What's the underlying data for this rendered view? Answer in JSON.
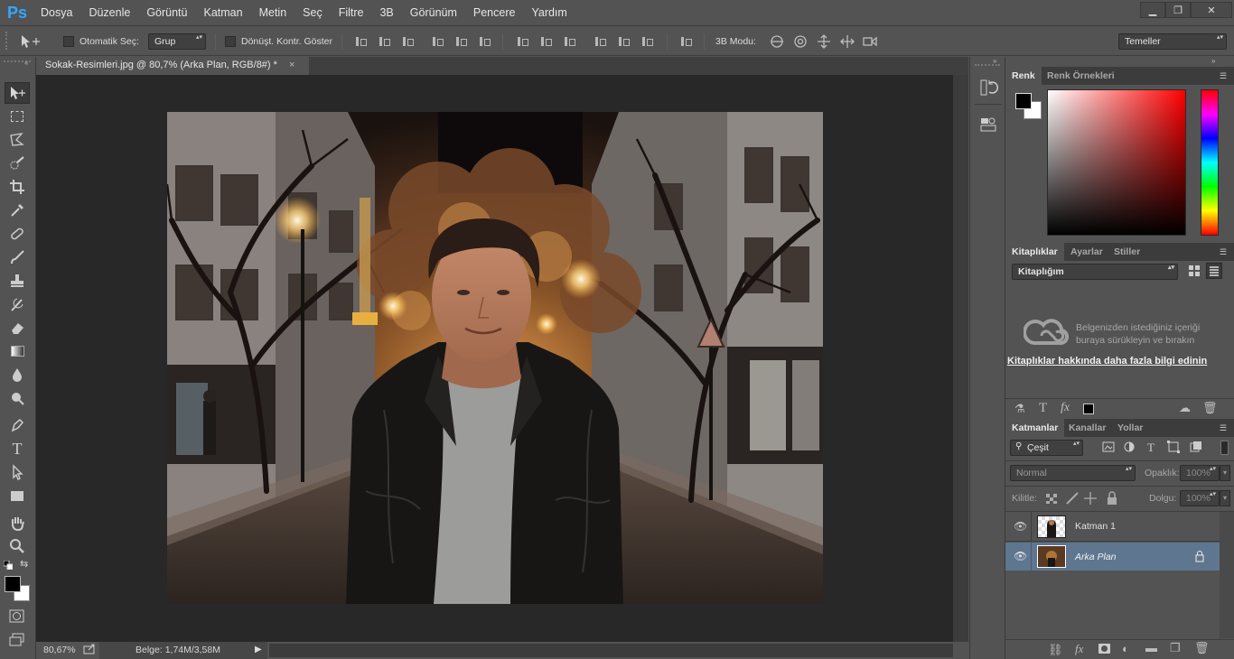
{
  "app": {
    "logo": "Ps"
  },
  "menu": [
    "Dosya",
    "Düzenle",
    "Görüntü",
    "Katman",
    "Metin",
    "Seç",
    "Filtre",
    "3B",
    "Görünüm",
    "Pencere",
    "Yardım"
  ],
  "window_controls": {
    "minimize": "▁",
    "restore": "❐",
    "close": "✕"
  },
  "options": {
    "auto_select_label": "Otomatik Seç:",
    "auto_select_value": "Grup",
    "transform_controls_label": "Dönüşt. Kontr. Göster",
    "mode_3d_label": "3B Modu:",
    "workspace_value": "Temeller"
  },
  "document_tab": {
    "title": "Sokak-Resimleri.jpg @ 80,7% (Arka Plan, RGB/8#) *",
    "close": "×"
  },
  "status": {
    "zoom": "80,67%",
    "doc_size": "Belge: 1,74M/3,58M"
  },
  "panels": {
    "color": {
      "tabs": [
        "Renk",
        "Renk Örnekleri"
      ],
      "active": "Renk"
    },
    "libraries": {
      "tabs": [
        "Kitaplıklar",
        "Ayarlar",
        "Stiller"
      ],
      "dropdown": "Kitaplığım",
      "message": "Belgenizden istediğiniz içeriği buraya sürükleyin ve bırakın",
      "link": "Kitaplıklar hakkında daha fazla bilgi edinin"
    },
    "layers": {
      "tabs": [
        "Katmanlar",
        "Kanallar",
        "Yollar"
      ],
      "filter": "Çeşit",
      "blend_mode": "Normal",
      "opacity_label": "Opaklık:",
      "opacity_value": "100%",
      "lock_label": "Kilitle:",
      "fill_label": "Dolgu:",
      "fill_value": "100%",
      "items": [
        {
          "name": "Katman 1",
          "italic": false,
          "selected": false
        },
        {
          "name": "Arka Plan",
          "italic": true,
          "selected": true
        }
      ]
    }
  },
  "colors": {
    "accent_ps": "#31a8ff",
    "selected_layer": "#5f7690",
    "foreground": "#000000",
    "background": "#ffffff"
  }
}
